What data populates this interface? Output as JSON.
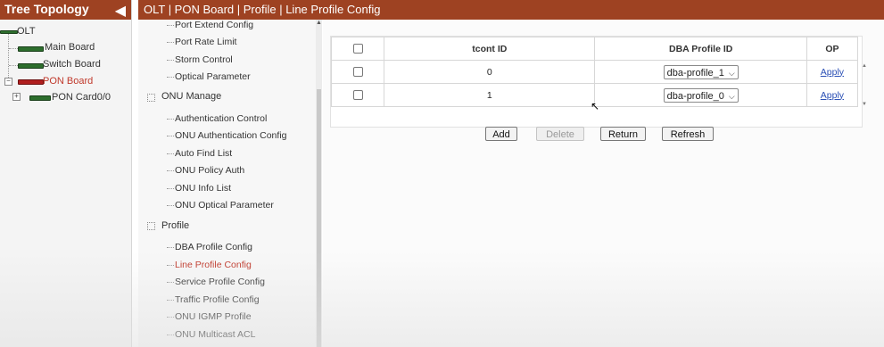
{
  "tree": {
    "title": "Tree Topology",
    "root": "OLT",
    "nodes": [
      "Main Board",
      "Switch Board",
      "PON Board"
    ],
    "child": "PON Card0/0"
  },
  "header": {
    "breadcrumb": "OLT | PON Board | Profile | Line Profile Config"
  },
  "menu": {
    "items_top": [
      "Port Extend Config",
      "Port Rate Limit",
      "Storm Control",
      "Optical Parameter"
    ],
    "onu_group": "ONU Manage",
    "onu_items": [
      "Authentication Control",
      "ONU Authentication Config",
      "Auto Find List",
      "ONU Policy Auth",
      "ONU Info List",
      "ONU Optical Parameter"
    ],
    "profile_group": "Profile",
    "profile_items": [
      "DBA Profile Config",
      "Line Profile Config",
      "Service Profile Config",
      "Traffic Profile Config",
      "ONU IGMP Profile",
      "ONU Multicast ACL"
    ],
    "active": "Line Profile Config"
  },
  "table": {
    "columns": [
      "tcont ID",
      "DBA Profile ID",
      "OP"
    ],
    "rows": [
      {
        "tcont_id": "0",
        "dba_profile": "dba-profile_1",
        "op": "Apply"
      },
      {
        "tcont_id": "1",
        "dba_profile": "dba-profile_0",
        "op": "Apply"
      }
    ]
  },
  "buttons": {
    "add": "Add",
    "delete": "Delete",
    "return": "Return",
    "refresh": "Refresh"
  },
  "colors": {
    "header_bg": "#9e4222",
    "active_menu": "#c0392b",
    "link": "#2a4fb5",
    "board_icon": "#2d6e2d"
  }
}
